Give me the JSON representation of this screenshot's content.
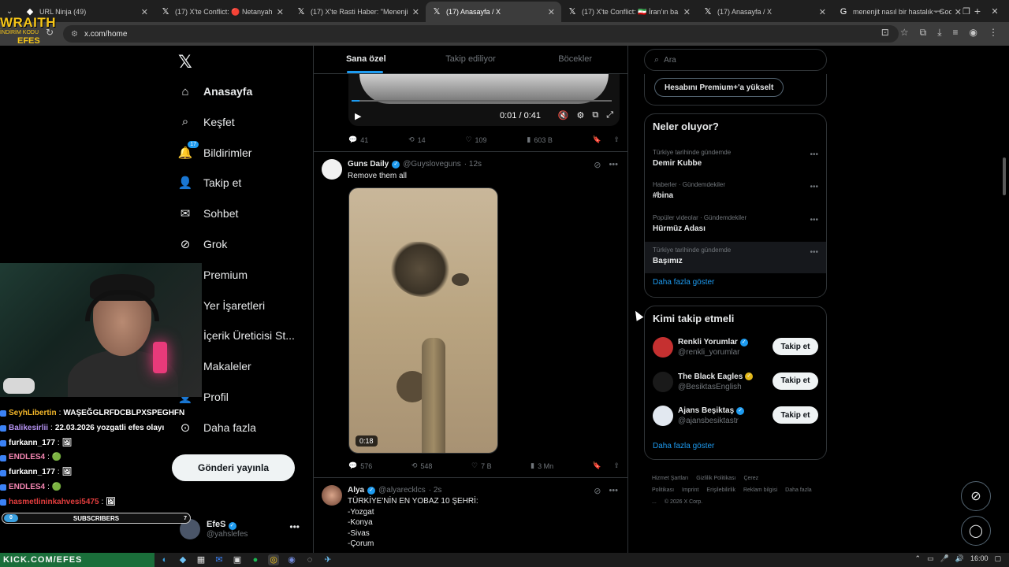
{
  "browser": {
    "tabs": [
      {
        "title": "URL Ninja (49)",
        "favicon": "ninja-icon",
        "active": false
      },
      {
        "title": "(17) X'te Conflict: 🔴 Netanyah",
        "favicon": "x-icon",
        "active": false
      },
      {
        "title": "(17) X'te Rasti Haber: \"Menenji",
        "favicon": "x-icon",
        "active": false
      },
      {
        "title": "(17) Anasayfa / X",
        "favicon": "x-icon",
        "active": true
      },
      {
        "title": "(17) X'te Conflict: 🇮🇷 İran'ın ba",
        "favicon": "x-icon",
        "active": false
      },
      {
        "title": "(17) Anasayfa / X",
        "favicon": "x-icon",
        "active": false
      },
      {
        "title": "menenjit nasıl bir hastalık - Goo",
        "favicon": "google-icon",
        "active": false
      }
    ],
    "url": "x.com/home"
  },
  "overlay": {
    "logo_line1": "WRAITH",
    "logo_line2": "İNDİRİM KODU",
    "logo_line3": "EFES",
    "chat": [
      {
        "user": "SeyhLibertin",
        "msg": "WAŞEĞGLRFDCBLPXSPEGHFN",
        "color": "#f0b429"
      },
      {
        "user": "Balikesirlii",
        "msg": "22.03.2026 yozgatli efes olayı",
        "color": "#b794f4"
      },
      {
        "user": "furkann_177",
        "msg": "🖼",
        "color": "#ffffff"
      },
      {
        "user": "ENDLES4",
        "msg": "🟢",
        "color": "#f687b3"
      },
      {
        "user": "furkann_177",
        "msg": "🖼",
        "color": "#ffffff"
      },
      {
        "user": "ENDLES4",
        "msg": "🟢",
        "color": "#f687b3"
      },
      {
        "user": "hasmetlininkahvesi5475",
        "msg": "🖼",
        "color": "#e53e3e"
      }
    ],
    "subs_label": "SUBSCRIBERS",
    "subs_left": "0",
    "subs_right": "7",
    "taskbar_brand": "KICK.COM/EFES"
  },
  "nav": {
    "items": [
      {
        "label": "Anasayfa",
        "icon": "home-icon"
      },
      {
        "label": "Keşfet",
        "icon": "search-icon"
      },
      {
        "label": "Bildirimler",
        "icon": "bell-icon",
        "badge": "17"
      },
      {
        "label": "Takip et",
        "icon": "add-user-icon"
      },
      {
        "label": "Sohbet",
        "icon": "mail-icon"
      },
      {
        "label": "Grok",
        "icon": "grok-icon"
      },
      {
        "label": "Premium",
        "icon": "x-premium-icon"
      },
      {
        "label": "Yer İşaretleri",
        "icon": "bookmark-icon"
      },
      {
        "label": "İçerik Üreticisi St...",
        "icon": "creator-icon"
      },
      {
        "label": "Makaleler",
        "icon": "article-icon"
      },
      {
        "label": "Profil",
        "icon": "profile-icon"
      },
      {
        "label": "Daha fazla",
        "icon": "more-circle-icon"
      }
    ],
    "post_button": "Gönderi yayınla",
    "account": {
      "name": "EfeS",
      "handle": "@yahslefes"
    }
  },
  "feed": {
    "tabs": [
      "Sana özel",
      "Takip ediliyor",
      "Böcekler"
    ],
    "video1": {
      "time": "0:01 / 0:41"
    },
    "post1_actions": {
      "replies": "41",
      "reposts": "14",
      "likes": "109",
      "views": "603 B"
    },
    "post2": {
      "name": "Guns Daily",
      "handle": "@Guysloveguns",
      "time": "· 12s",
      "text": "Remove them all",
      "duration": "0:18",
      "replies": "576",
      "reposts": "548",
      "likes": "7 B",
      "views": "3 Mn"
    },
    "post3": {
      "name": "Alya",
      "handle": "@alyarecklcs",
      "time": "· 2s",
      "text": "TÜRKİYE'NİN EN YOBAZ 10 ŞEHRİ:\n-Yozgat\n-Konya\n-Sivas\n-Çorum"
    }
  },
  "right": {
    "search_placeholder": "Ara",
    "premium_button": "Hesabını Premium+'a yükselt",
    "trends_title": "Neler oluyor?",
    "trends": [
      {
        "category": "Türkiye tarihinde gündemde",
        "name": "Demir Kubbe"
      },
      {
        "category": "Haberler · Gündemdekiler",
        "name": "#bina"
      },
      {
        "category": "Popüler videolar · Gündemdekiler",
        "name": "Hürmüz Adası"
      },
      {
        "category": "Türkiye tarihinde gündemde",
        "name": "Başımız"
      }
    ],
    "show_more": "Daha fazla göster",
    "follow_title": "Kimi takip etmeli",
    "follow": [
      {
        "name": "Renkli Yorumlar",
        "handle": "@renkli_yorumlar",
        "avatar_color": "#c53030"
      },
      {
        "name": "The Black Eagles",
        "handle": "@BesiktasEnglish",
        "avatar_color": "#1a1a1a"
      },
      {
        "name": "Ajans Beşiktaş",
        "handle": "@ajansbesiktastr",
        "avatar_color": "#e2e8f0"
      }
    ],
    "follow_button": "Takip et",
    "footer": [
      "Hizmet Şartları",
      "Gizlilik Politikası",
      "Çerez Politikası",
      "Imprint",
      "Erişilebilirlik",
      "Reklam bilgisi",
      "Daha fazla ...",
      "© 2026 X Corp."
    ]
  },
  "taskbar": {
    "clock": "16:00"
  }
}
